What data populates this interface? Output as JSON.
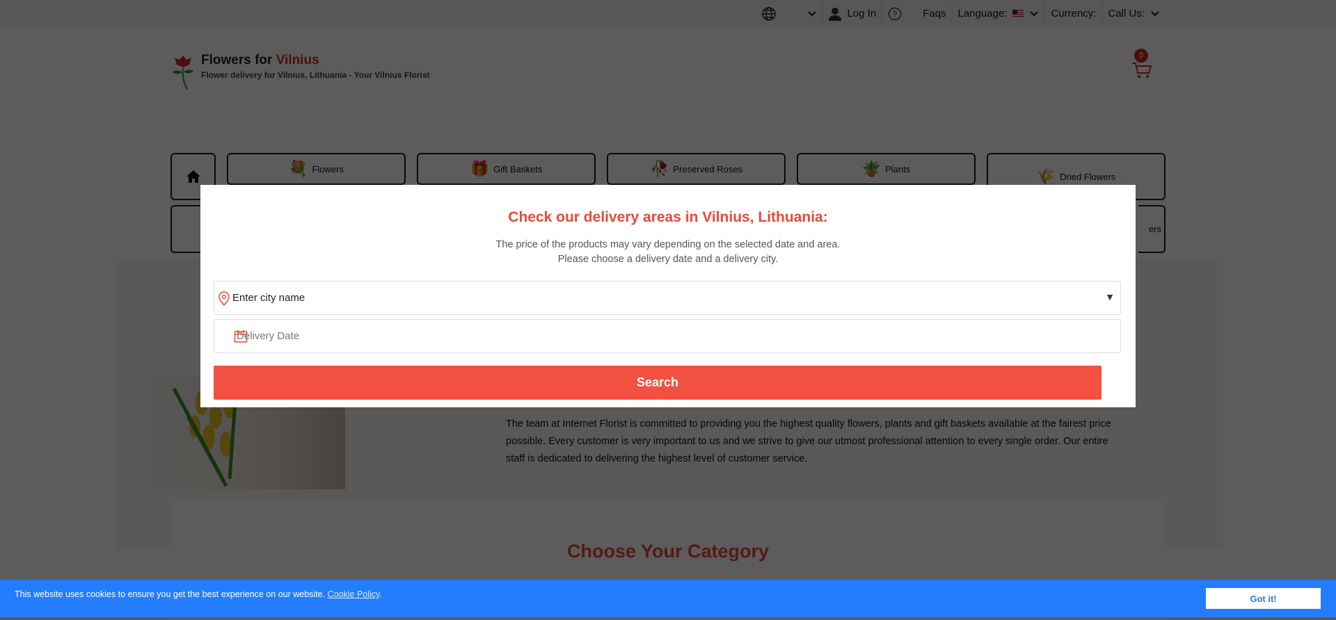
{
  "topbar": {
    "login": "Log In",
    "faqs": "Faqs",
    "language_label": "Language:",
    "currency_label": "Currency:",
    "call_us": "Call Us:"
  },
  "logo": {
    "name_main": "Flowers for ",
    "name_accent": "Vilnius",
    "tagline": "Flower delivery for Vilnius, Lithuania - Your Vilnius Florist"
  },
  "cart": {
    "count": "0"
  },
  "nav": {
    "row1": [
      "Flowers",
      "Gift Baskets",
      "Preserved Roses",
      "Plants",
      "Dried Flowers"
    ],
    "row2_partial": "ers"
  },
  "about": {
    "text": "The team at Internet Florist is committed to providing you the highest quality flowers, plants and gift baskets available at the fairest price possible. Every customer is very important to us and we strive to give our utmost professional attention to every single order. Our entire staff is dedicated to delivering the highest level of customer service."
  },
  "category": {
    "title": "Choose Your Category"
  },
  "modal": {
    "title": "Check our delivery areas in Vilnius, Lithuania:",
    "line1": "The price of the products may vary depending on the selected date and area.",
    "line2": "Please choose a delivery date and a delivery city.",
    "city_placeholder": "Enter city name",
    "date_placeholder": "Delivery Date",
    "search": "Search"
  },
  "cookie": {
    "text": "This website uses cookies to ensure you get the best experience on our website.",
    "link": "Cookie Policy",
    "button": "Got it!"
  },
  "colors": {
    "accent": "#f25142",
    "title_red": "#e8493a",
    "cookie_blue": "#247dff"
  }
}
